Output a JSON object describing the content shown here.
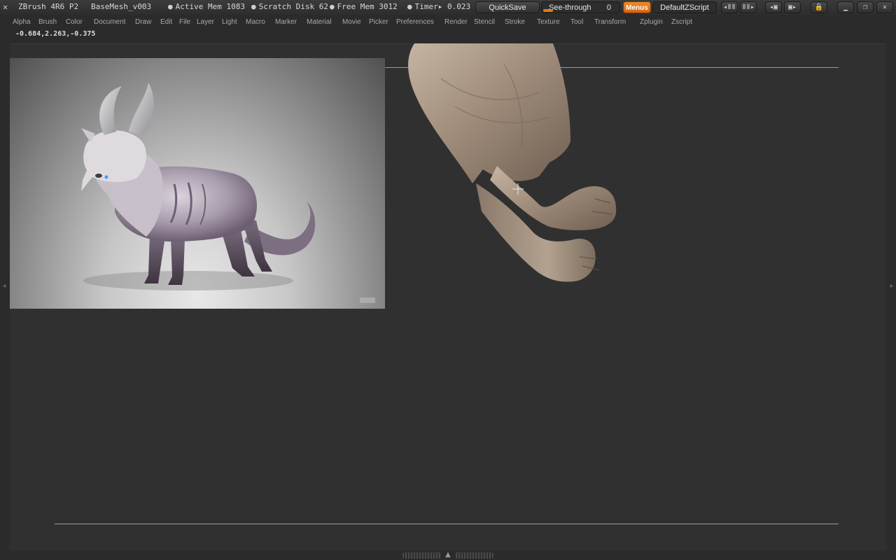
{
  "titlebar": {
    "app": "ZBrush 4R6 P2",
    "document": "BaseMesh_v003",
    "active_mem": "Active Mem 1083",
    "scratch_disk": "Scratch Disk 62",
    "free_mem": "Free Mem 3012",
    "timer": "Timer▸ 0.023",
    "quicksave": "QuickSave",
    "see_through_label": "See-through",
    "see_through_value": "0",
    "menus": "Menus",
    "zscript": "DefaultZScript"
  },
  "menubar": {
    "items": [
      "Alpha",
      "Brush",
      "Color",
      "Document",
      "Draw",
      "Edit",
      "File",
      "Layer",
      "Light",
      "Macro",
      "Marker",
      "Material",
      "Movie",
      "Picker",
      "Preferences",
      "Render",
      "Stencil",
      "Stroke",
      "Texture",
      "Tool",
      "Transform",
      "Zplugin",
      "Zscript"
    ]
  },
  "coords": "-0.684,2.263,-0.375",
  "colors": {
    "accent": "#e2791d",
    "background": "#2b2b2b",
    "canvas": "#303030"
  },
  "icons": {
    "logo": "zbrush-logo-icon",
    "lock": "lock-icon",
    "minimize": "minimize-icon",
    "restore": "restore-icon"
  }
}
